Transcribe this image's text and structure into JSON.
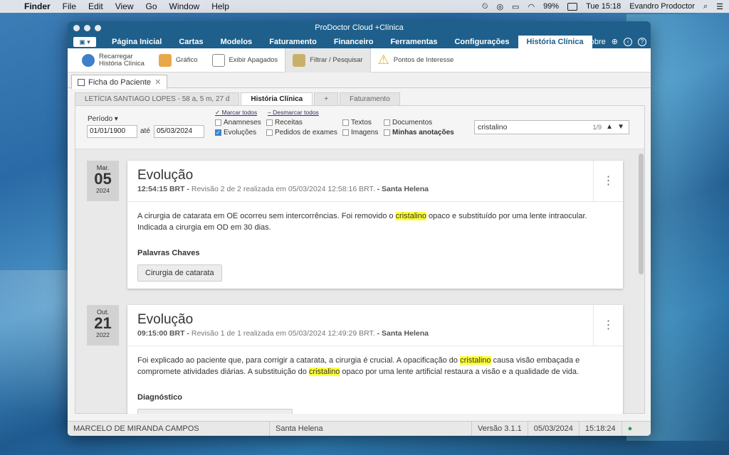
{
  "menubar": {
    "app": "Finder",
    "items": [
      "File",
      "Edit",
      "View",
      "Go",
      "Window",
      "Help"
    ],
    "battery": "99%",
    "clock": "Tue 15:18",
    "user": "Evandro Prodoctor"
  },
  "window": {
    "title": "ProDoctor Cloud +Clínica"
  },
  "nav": {
    "items": [
      "Página Inicial",
      "Cartas",
      "Modelos",
      "Faturamento",
      "Financeiro",
      "Ferramentas",
      "Configurações",
      "História Clínica"
    ],
    "active": "História Clínica",
    "about": "Sobre"
  },
  "toolbar": {
    "reload": "Recarregar\nHistória Clínica",
    "chart": "Gráfico",
    "deleted": "Exibir Apagados",
    "filter": "Filtrar / Pesquisar",
    "points": "Pontos de Interesse"
  },
  "doc_tab": "Ficha do Paciente",
  "patient_tabs": [
    "LETÍCIA SANTIAGO LOPES - 58 a, 5 m, 27 d",
    "História Clínica",
    "+",
    "Faturamento"
  ],
  "filters": {
    "period_label": "Período",
    "date_from": "01/01/1900",
    "until": "até",
    "date_to": "05/03/2024",
    "mark_all": "Marcar todos",
    "unmark_all": "Desmarcar todos",
    "options": {
      "anamneses": "Anamneses",
      "evolucoes": "Evoluções",
      "receitas": "Receitas",
      "pedidos": "Pedidos de exames",
      "textos": "Textos",
      "imagens": "Imagens",
      "documentos": "Documentos",
      "anotacoes": "Minhas anotações"
    },
    "search_value": "cristalino",
    "search_count": "1/9"
  },
  "entries": [
    {
      "month": "Mar.",
      "day": "05",
      "year": "2024",
      "title": "Evolução",
      "time": "12:54:15 BRT -",
      "revision": "Revisão 2 de 2 realizada em 05/03/2024 12:58:16 BRT.",
      "place": "- Santa Helena",
      "text_a": "A cirurgia de catarata em OE ocorreu sem intercorrências. Foi removido o ",
      "hl1": "cristalino",
      "text_b": " opaco e substituído por uma lente intraocular. Indicada a cirurgia em OD em 30 dias.",
      "section": "Palavras Chaves",
      "keyword": "Cirurgia de catarata"
    },
    {
      "month": "Out.",
      "day": "21",
      "year": "2022",
      "title": "Evolução",
      "time": "09:15:00 BRT -",
      "revision": "Revisão 1 de 1 realizada em 05/03/2024 12:49:29 BRT.",
      "place": "- Santa Helena",
      "text_a": "Foi explicado ao paciente que, para corrigir a catarata, a cirurgia é crucial. A opacificação do ",
      "hl1": "cristalino",
      "text_b": " causa visão embaçada e compromete atividades diárias. A substituição do ",
      "hl2": "cristalino",
      "text_c": " opaco por uma lente artificial restaura a visão e a qualidade de vida.",
      "section": "Diagnóstico"
    }
  ],
  "status": {
    "doctor": "MARCELO DE MIRANDA CAMPOS",
    "place": "Santa Helena",
    "version": "Versão 3.1.1",
    "date": "05/03/2024",
    "time": "15:18:24"
  }
}
